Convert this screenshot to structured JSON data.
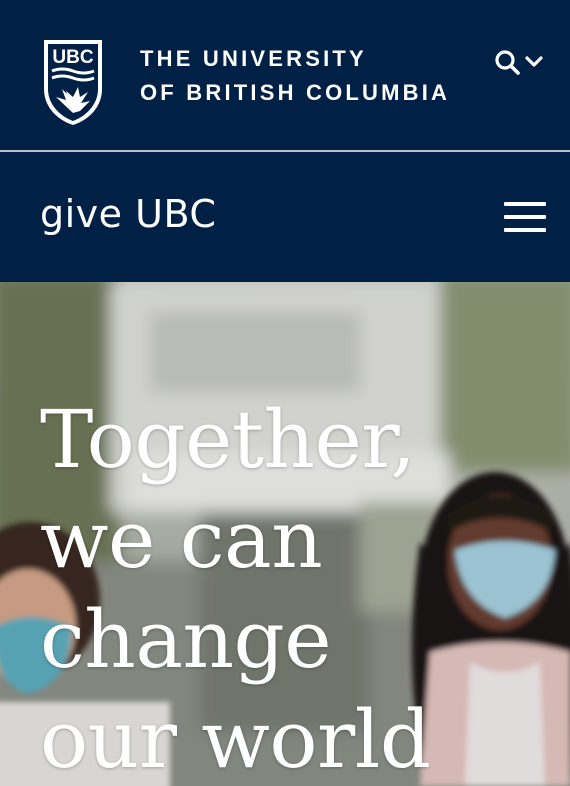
{
  "header": {
    "logo_text": "UBC",
    "university_line1": "THE UNIVERSITY",
    "university_line2": "OF BRITISH COLUMBIA",
    "search_icon": "search-icon",
    "dropdown_icon": "chevron-down-icon"
  },
  "subheader": {
    "site_name": "give UBC",
    "menu_icon": "hamburger-icon"
  },
  "hero": {
    "title_lines": [
      "Together,",
      "we can",
      "change",
      "our world"
    ]
  },
  "colors": {
    "brand_navy": "#002145",
    "divider": "#b7c2cf",
    "text": "#ffffff"
  }
}
